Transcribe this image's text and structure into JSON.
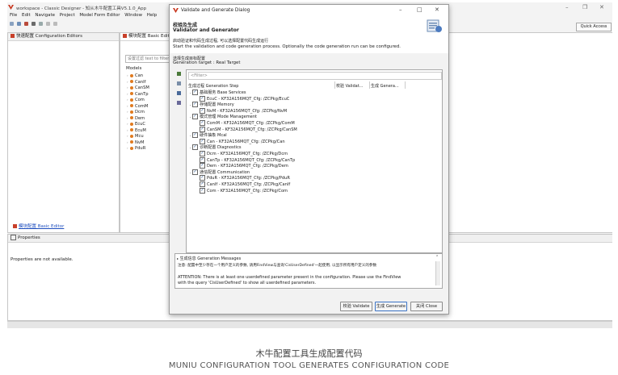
{
  "app": {
    "title": "workspace - Classic Designer - 知从木牛配置工具V5.1.0_App",
    "menu": [
      "File",
      "Edit",
      "Navigate",
      "Project",
      "Model Form Editor",
      "Window",
      "Help"
    ],
    "quick_access": "Quick Access",
    "win_controls": [
      "–",
      "❐",
      "✕"
    ]
  },
  "left_panel": {
    "tab": "快速配置 Configuration Editors",
    "footer_link": "模块配置 Basic Editor"
  },
  "editor_panel": {
    "tab": "模块配置 Basic Edit",
    "filter_placeholder": "设置过滤 text to filter",
    "models_label": "Models",
    "models": [
      "Can",
      "CanIf",
      "CanSM",
      "CanTp",
      "Com",
      "ComM",
      "Dcm",
      "Dem",
      "EcuC",
      "EcuM",
      "Mcu",
      "NvM",
      "PduR"
    ]
  },
  "properties_panel": {
    "tab": "Properties",
    "message": "Properties are not available."
  },
  "dialog": {
    "title": "Validate and Generate Dialog",
    "heading_cn": "校验及生成",
    "heading_en": "Validator and Generator",
    "desc_cn": "启动验证和代码生成过程, 可以选择配置代码生成运行",
    "desc_en": "Start the validation and code generation process. Optionally the code generation run can be configured.",
    "target_cn": "选择生成目标配置",
    "target_en": "Generation target : Real Target",
    "filter_placeholder": "<Filter>",
    "columns": [
      "生成过程 Generation Step",
      "校验 Validat...",
      "生成 Genera..."
    ],
    "groups": [
      {
        "label": "基础服务 Base Services",
        "items": [
          "EcuC - KF32A156MQT_Cfg: /ZCPkg/EcuC"
        ]
      },
      {
        "label": "存储配置 Memory",
        "items": [
          "NvM - KF32A156MQT_Cfg: /ZCPkg/NvM"
        ]
      },
      {
        "label": "模式管理 Mode Management",
        "items": [
          "ComM - KF32A156MQT_Cfg: /ZCPkg/ComM",
          "CanSM - KF32A156MQT_Cfg: /ZCPkg/CanSM"
        ]
      },
      {
        "label": "硬件抽象 Mcal",
        "items": [
          "Can - KF32A156MQT_Cfg: /ZCPkg/Can"
        ]
      },
      {
        "label": "诊断配置 Diagnostics",
        "items": [
          "Dcm - KF32A156MQT_Cfg: /ZCPkg/Dcm",
          "CanTp - KF32A156MQT_Cfg: /ZCPkg/CanTp",
          "Dem - KF32A156MQT_Cfg: /ZCPkg/Dem"
        ]
      },
      {
        "label": "通信配置 Communication",
        "items": [
          "PduR - KF32A156MQT_Cfg: /ZCPkg/PduR",
          "CanIf - KF32A156MQT_Cfg: /ZCPkg/CanIf",
          "Com - KF32A156MQT_Cfg: /ZCPkg/Com"
        ]
      }
    ],
    "messages_title": "生成信息 Generation Messages",
    "msg_cn": "注意: 配置中至少存在一个用户定义的参数, 请用FindView与查询'CisUserDefined'一起使用, 以显示所有用户定义的参数",
    "msg_en1": "ATTENTION: There is at least one userdefined parameter present in the configuration. Please use the FindView",
    "msg_en2": "with the query 'CisUserDefined' to show all userdefined parameters.",
    "buttons": {
      "validate": "校验 Validate",
      "generate": "生成 Generate",
      "close": "关闭 Close"
    }
  },
  "caption": {
    "cn": "木牛配置工具生成配置代码",
    "en": "MUNIU CONFIGURATION TOOL GENERATES CONFIGURATION CODE"
  },
  "colors": {
    "accent": "#d9541e",
    "selection": "#cfe3f7",
    "link": "#1f4fbf"
  }
}
